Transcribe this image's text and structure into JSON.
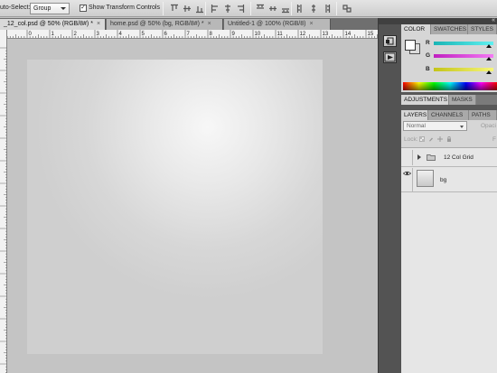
{
  "options_bar": {
    "auto_select_label": "uto-Select:",
    "auto_select_value": "Group",
    "show_transform_checked": "✓",
    "show_transform_label": "Show Transform Controls",
    "align_icons": [
      "align-top-edges-icon",
      "align-vertical-centers-icon",
      "align-bottom-edges-icon",
      "align-left-edges-icon",
      "align-horizontal-centers-icon",
      "align-right-edges-icon",
      "distribute-top-icon",
      "distribute-vertical-centers-icon",
      "distribute-bottom-icon",
      "distribute-left-icon",
      "distribute-horizontal-centers-icon",
      "distribute-right-icon",
      "auto-align-layers-icon"
    ]
  },
  "tabs": [
    {
      "label": "_12_col.psd @ 50% (RGB/8#) *",
      "active": true
    },
    {
      "label": "home.psd @ 50% (bg, RGB/8#) *",
      "active": false
    },
    {
      "label": "Untitled-1 @ 100% (RGB/8)",
      "active": false
    }
  ],
  "tab_close_glyph": "×",
  "ruler_ticks": [
    "0",
    "1",
    "2",
    "3",
    "4",
    "5",
    "6",
    "7",
    "8",
    "9",
    "10",
    "11",
    "12",
    "13",
    "14",
    "15",
    "16"
  ],
  "panels": {
    "color_tabs": [
      "COLOR",
      "SWATCHES",
      "STYLES"
    ],
    "channels": [
      {
        "label": "R",
        "color": "#22c8c8"
      },
      {
        "label": "G",
        "color": "#d432d4"
      },
      {
        "label": "B",
        "color": "#d8d820"
      }
    ],
    "adjust_tabs": [
      "ADJUSTMENTS",
      "MASKS"
    ],
    "layers_tabs": [
      "LAYERS",
      "CHANNELS",
      "PATHS"
    ],
    "blend_mode": "Normal",
    "opacity_label": "Opaci",
    "lock_label": "Lock:",
    "fill_label": "F",
    "collapse_glyph": "«"
  },
  "layers": [
    {
      "name": "12 Col Grid",
      "type": "group",
      "visible": false
    },
    {
      "name": "bg",
      "type": "layer",
      "visible": true
    }
  ]
}
